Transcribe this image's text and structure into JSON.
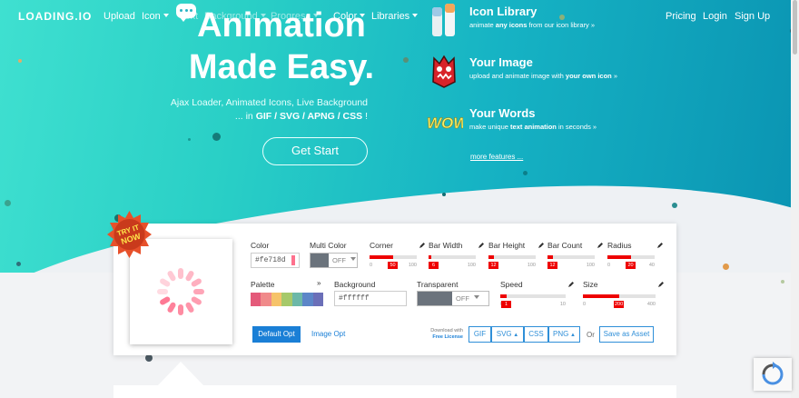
{
  "nav": {
    "logo": "LOADING.IO",
    "items": [
      "Upload",
      "Icon",
      "Text",
      "Background",
      "Progress",
      "Color",
      "Libraries"
    ],
    "right": [
      "Pricing",
      "Login",
      "Sign Up"
    ]
  },
  "hero": {
    "title_line1": "Animation",
    "title_line2": "Made Easy.",
    "subtitle_line1": "Ajax Loader, Animated Icons, Live Background",
    "subtitle_prefix": "... in ",
    "subtitle_formats": "GIF / SVG / APNG / CSS",
    "subtitle_suffix": " !",
    "cta": "Get Start"
  },
  "features": [
    {
      "title": "Icon Library",
      "desc_pre": "animate ",
      "desc_bold": "any icons",
      "desc_post": " from our icon library »",
      "icon": "paint-tubes-icon"
    },
    {
      "title": "Your Image",
      "desc_pre": "upload and animate image with ",
      "desc_bold": "your own icon",
      "desc_post": " »",
      "icon": "monster-image-icon"
    },
    {
      "title": "Your Words",
      "desc_pre": "make unique ",
      "desc_bold": "text animation",
      "desc_post": " in seconds »",
      "icon": "wow-text-icon"
    }
  ],
  "more_features": "more features ...",
  "panel": {
    "badge_line1": "TRY IT",
    "badge_line2": "NOW",
    "color": {
      "label": "Color",
      "value": "#fe718d"
    },
    "multi_color": {
      "label": "Multi Color",
      "state": "OFF"
    },
    "sliders": [
      {
        "label": "Corner",
        "value": "50",
        "fraction": 0.5,
        "min": "0",
        "max": "100"
      },
      {
        "label": "Bar Width",
        "value": "6",
        "fraction": 0.06,
        "min": "0",
        "max": "100"
      },
      {
        "label": "Bar Height",
        "value": "12",
        "fraction": 0.12,
        "min": "0",
        "max": "100"
      },
      {
        "label": "Bar Count",
        "value": "12",
        "fraction": 0.12,
        "min": "0",
        "max": "100"
      },
      {
        "label": "Radius",
        "value": "20",
        "fraction": 0.5,
        "min": "0",
        "max": "40"
      },
      {
        "label": "Speed",
        "value": "1",
        "fraction": 0.1,
        "min": "0.01",
        "max": "10"
      },
      {
        "label": "Size",
        "value": "200",
        "fraction": 0.5,
        "min": "0",
        "max": "400"
      }
    ],
    "palette": {
      "label": "Palette",
      "colors": [
        "#e45a7a",
        "#f08a8a",
        "#f6c36a",
        "#a6c96a",
        "#6cb8a8",
        "#5c86c8",
        "#6b6fb8"
      ]
    },
    "background": {
      "label": "Background",
      "value": "#ffffff"
    },
    "transparent": {
      "label": "Transparent",
      "state": "OFF"
    },
    "default_opt": "Default Opt",
    "image_opt": "Image Opt",
    "download_line1": "Download with",
    "download_line2": "Free License",
    "formats": [
      "GIF",
      "SVG",
      "CSS",
      "PNG"
    ],
    "or": "Or",
    "save_asset": "Save as Asset"
  },
  "colors": {
    "accent": "#1a7fd6",
    "spinner": "#fe718d",
    "slider": "#ee0000"
  }
}
